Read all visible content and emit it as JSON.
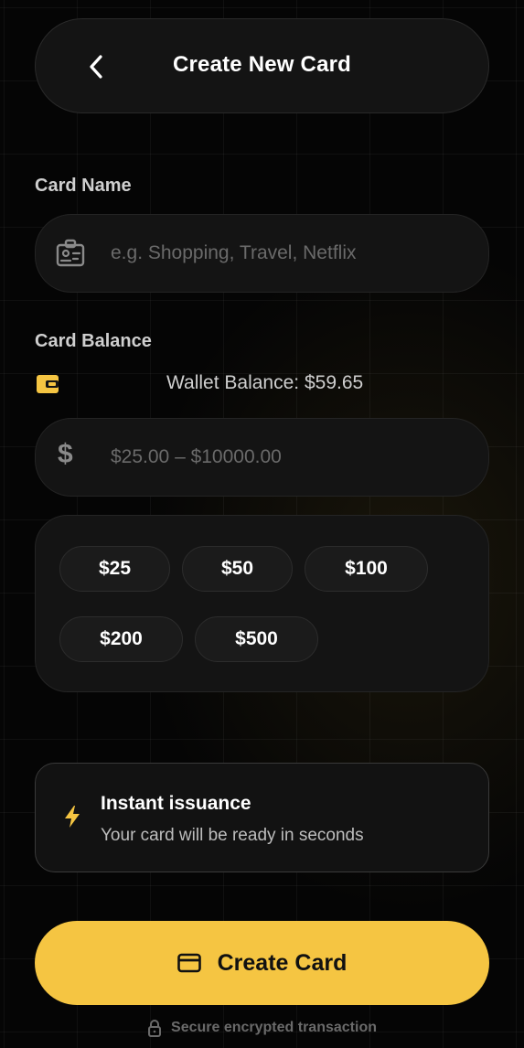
{
  "header": {
    "back_icon": "chevron-left-icon",
    "title": "Create New Card"
  },
  "card_name": {
    "label": "Card Name",
    "icon": "id-card-icon",
    "value": "",
    "placeholder": "e.g. Shopping, Travel, Netflix"
  },
  "card_balance": {
    "label": "Card Balance",
    "wallet_icon": "wallet-icon",
    "wallet_balance": "Wallet Balance: $59.65",
    "currency_symbol": "$",
    "value": "",
    "placeholder": "$25.00 – $10000.00"
  },
  "quick_amounts": [
    {
      "label": "$25"
    },
    {
      "label": "$50"
    },
    {
      "label": "$100"
    },
    {
      "label": "$200"
    },
    {
      "label": "$500"
    }
  ],
  "info": {
    "icon": "lightning-bolt-icon",
    "title": "Instant issuance",
    "subtitle": "Your card will be ready in seconds"
  },
  "create_button": {
    "icon": "credit-card-icon",
    "label": "Create Card"
  },
  "footer": {
    "icon": "lock-icon",
    "text": "Secure encrypted transaction"
  },
  "colors": {
    "accent": "#f5c542",
    "background": "#050505",
    "surface": "#141414"
  }
}
